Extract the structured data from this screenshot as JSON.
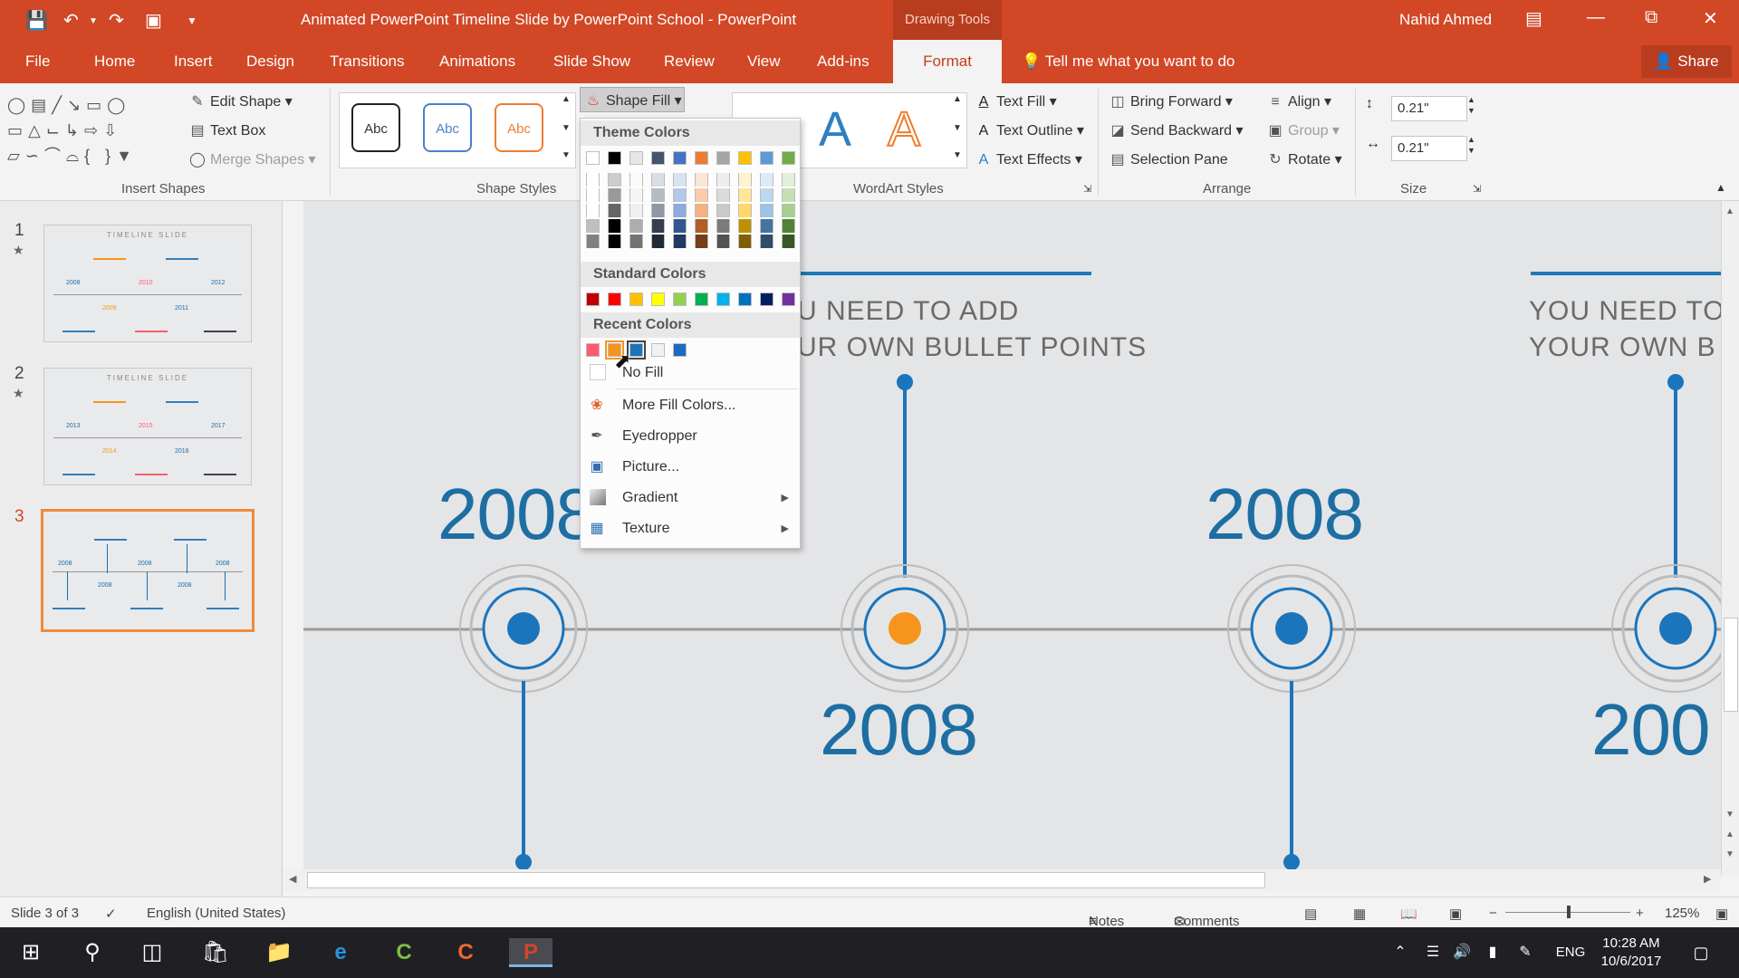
{
  "titlebar": {
    "doc_title": "Animated PowerPoint Timeline Slide by PowerPoint School  -  PowerPoint",
    "context_tab": "Drawing Tools",
    "user": "Nahid Ahmed"
  },
  "tabs": [
    "File",
    "Home",
    "Insert",
    "Design",
    "Transitions",
    "Animations",
    "Slide Show",
    "Review",
    "View",
    "Add-ins"
  ],
  "active_tab": "Format",
  "tell_me": "Tell me what you want to do",
  "share": "Share",
  "ribbon": {
    "insert_shapes": {
      "label": "Insert Shapes",
      "edit_shape": "Edit Shape",
      "text_box": "Text Box",
      "merge_shapes": "Merge Shapes"
    },
    "shape_styles": {
      "label": "Shape Styles",
      "sample": "Abc",
      "shape_fill": "Shape Fill"
    },
    "wordart": {
      "label": "WordArt Styles",
      "glyph": "A",
      "text_fill": "Text Fill",
      "text_outline": "Text Outline",
      "text_effects": "Text Effects"
    },
    "arrange": {
      "label": "Arrange",
      "bring_forward": "Bring Forward",
      "send_backward": "Send Backward",
      "selection_pane": "Selection Pane",
      "align": "Align",
      "group": "Group",
      "rotate": "Rotate"
    },
    "size": {
      "label": "Size",
      "height": "0.21\"",
      "width": "0.21\""
    }
  },
  "fill_menu": {
    "theme_header": "Theme Colors",
    "standard_header": "Standard Colors",
    "recent_header": "Recent Colors",
    "no_fill": "No Fill",
    "more_colors": "More Fill Colors...",
    "eyedropper": "Eyedropper",
    "picture": "Picture...",
    "gradient": "Gradient",
    "texture": "Texture",
    "theme_colors": [
      "#ffffff",
      "#000000",
      "#e7e6e6",
      "#44546a",
      "#4472c4",
      "#ed7d31",
      "#a5a5a5",
      "#ffc000",
      "#5b9bd5",
      "#70ad47"
    ],
    "standard_colors": [
      "#c00000",
      "#ff0000",
      "#ffc000",
      "#ffff00",
      "#92d050",
      "#00b050",
      "#00b0f0",
      "#0070c0",
      "#002060",
      "#7030a0"
    ],
    "recent_colors": [
      "#ff5b6e",
      "#f7941d",
      "#1b75bc",
      "#f2f2f2",
      "#1c6bc0"
    ]
  },
  "slides": [
    {
      "num": "1",
      "title": "TIMELINE SLIDE",
      "years": [
        "2008",
        "2009",
        "2010",
        "2011",
        "2012"
      ]
    },
    {
      "num": "2",
      "title": "TIMELINE SLIDE",
      "years": [
        "2013",
        "2014",
        "2015",
        "2016",
        "2017"
      ]
    },
    {
      "num": "3",
      "title": "",
      "years": [
        "2008",
        "2008",
        "2008",
        "2008"
      ]
    }
  ],
  "canvas": {
    "bullet_a_1": "U NEED TO ADD",
    "bullet_a_2": "UR OWN BULLET POINTS",
    "bullet_b_1": "YOU NEED TO",
    "bullet_b_2": "YOUR OWN B",
    "year_top_left": "2008",
    "year_top_right": "2008",
    "year_bottom_mid": "2008",
    "year_bottom_right": "200",
    "colors": {
      "blue": "#1b75bc",
      "orange": "#f7941d",
      "ring": "#bdbdbd"
    }
  },
  "status": {
    "slide": "Slide 3 of 3",
    "language": "English (United States)",
    "notes": "Notes",
    "comments": "Comments",
    "zoom": "125%"
  },
  "taskbar": {
    "lang": "ENG",
    "time": "10:28 AM",
    "date": "10/6/2017"
  }
}
